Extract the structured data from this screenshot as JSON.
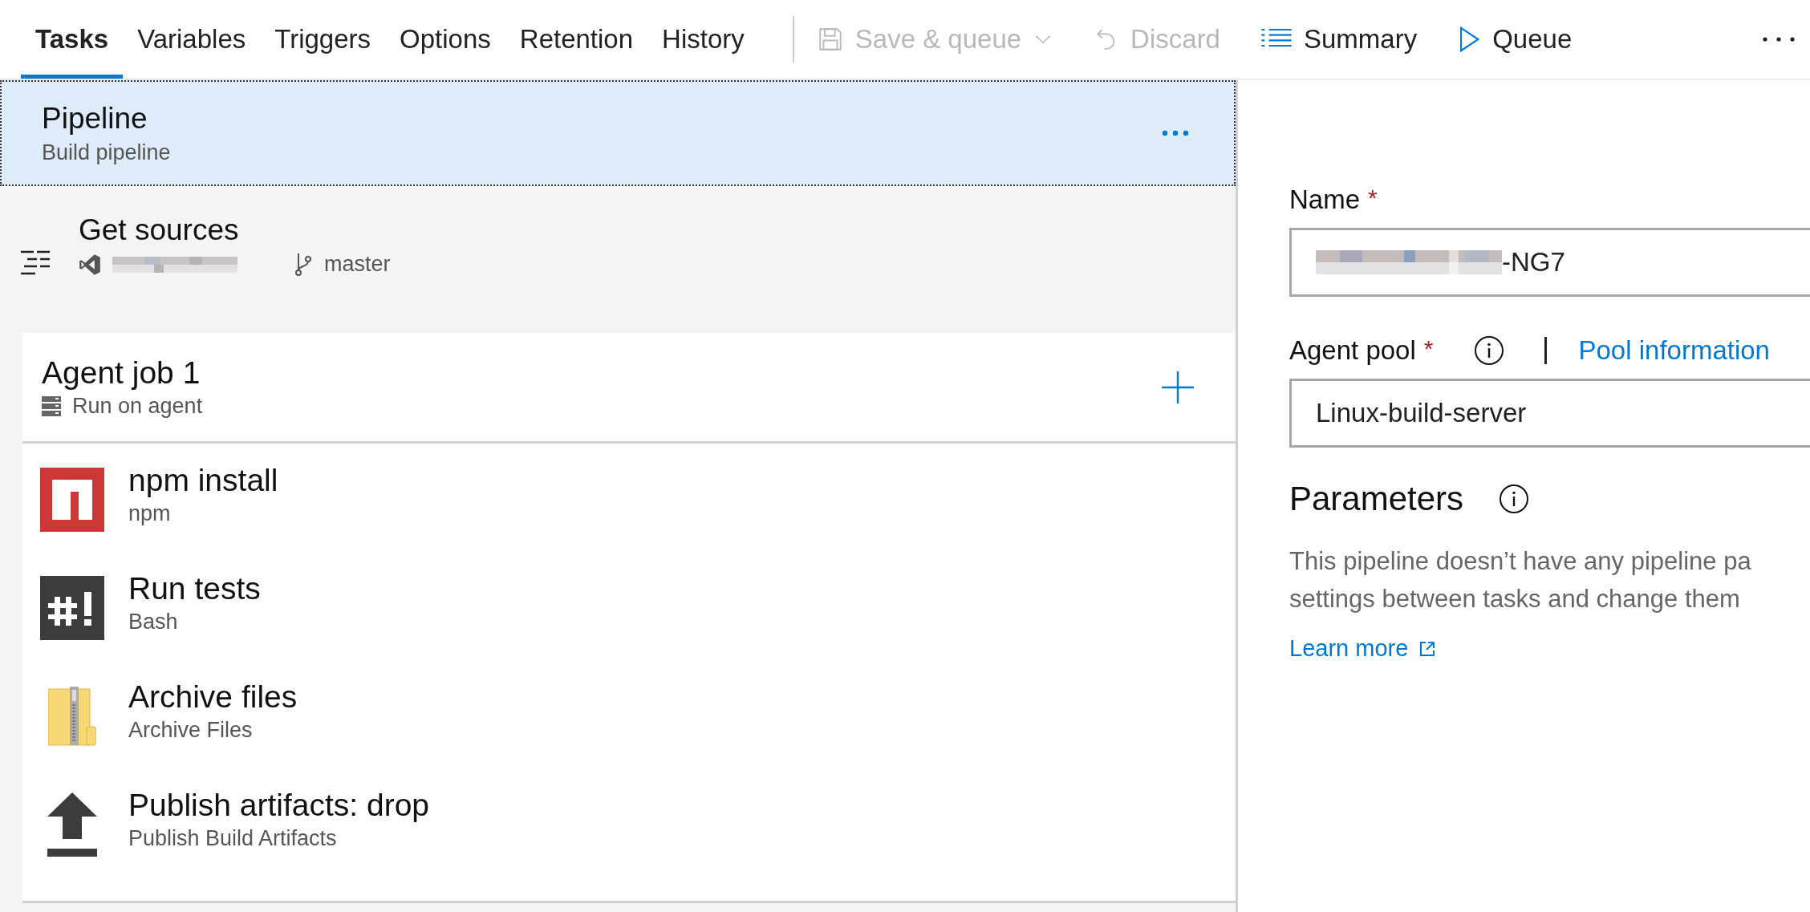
{
  "toolbar": {
    "tabs": [
      {
        "label": "Tasks",
        "selected": true
      },
      {
        "label": "Variables",
        "selected": false
      },
      {
        "label": "Triggers",
        "selected": false
      },
      {
        "label": "Options",
        "selected": false
      },
      {
        "label": "Retention",
        "selected": false
      },
      {
        "label": "History",
        "selected": false
      }
    ],
    "actions": [
      {
        "kind": "save",
        "label": "Save & queue",
        "disabled": true
      },
      {
        "kind": "discard",
        "label": "Discard",
        "disabled": true
      },
      {
        "kind": "summary",
        "label": "Summary",
        "disabled": false
      },
      {
        "kind": "queue",
        "label": "Queue",
        "disabled": false
      },
      {
        "kind": "more",
        "disabled": false
      }
    ]
  },
  "pipeline": {
    "title": "Pipeline",
    "subtitle": "Build pipeline",
    "selected": true
  },
  "get_sources": {
    "title": "Get sources",
    "branch": "master"
  },
  "agent_job": {
    "title": "Agent job 1",
    "subtitle": "Run on agent"
  },
  "tasks": [
    {
      "kind": "npm",
      "title": "npm install",
      "subtitle": "npm"
    },
    {
      "kind": "bash",
      "title": "Run tests",
      "subtitle": "Bash"
    },
    {
      "kind": "archive",
      "title": "Archive files",
      "subtitle": "Archive Files"
    },
    {
      "kind": "publish",
      "title": "Publish artifacts: drop",
      "subtitle": "Publish Build Artifacts"
    }
  ],
  "properties": {
    "name": {
      "label": "Name",
      "required_mark": "*",
      "value": "-NG7"
    },
    "agent_pool": {
      "label": "Agent pool",
      "required_mark": "*",
      "link": "Pool information",
      "value": "Linux-build-server"
    },
    "parameters": {
      "title": "Parameters",
      "description_lines": [
        "This pipeline doesn’t have any pipeline pa",
        "settings between tasks and change them"
      ],
      "link": "Learn more"
    }
  }
}
